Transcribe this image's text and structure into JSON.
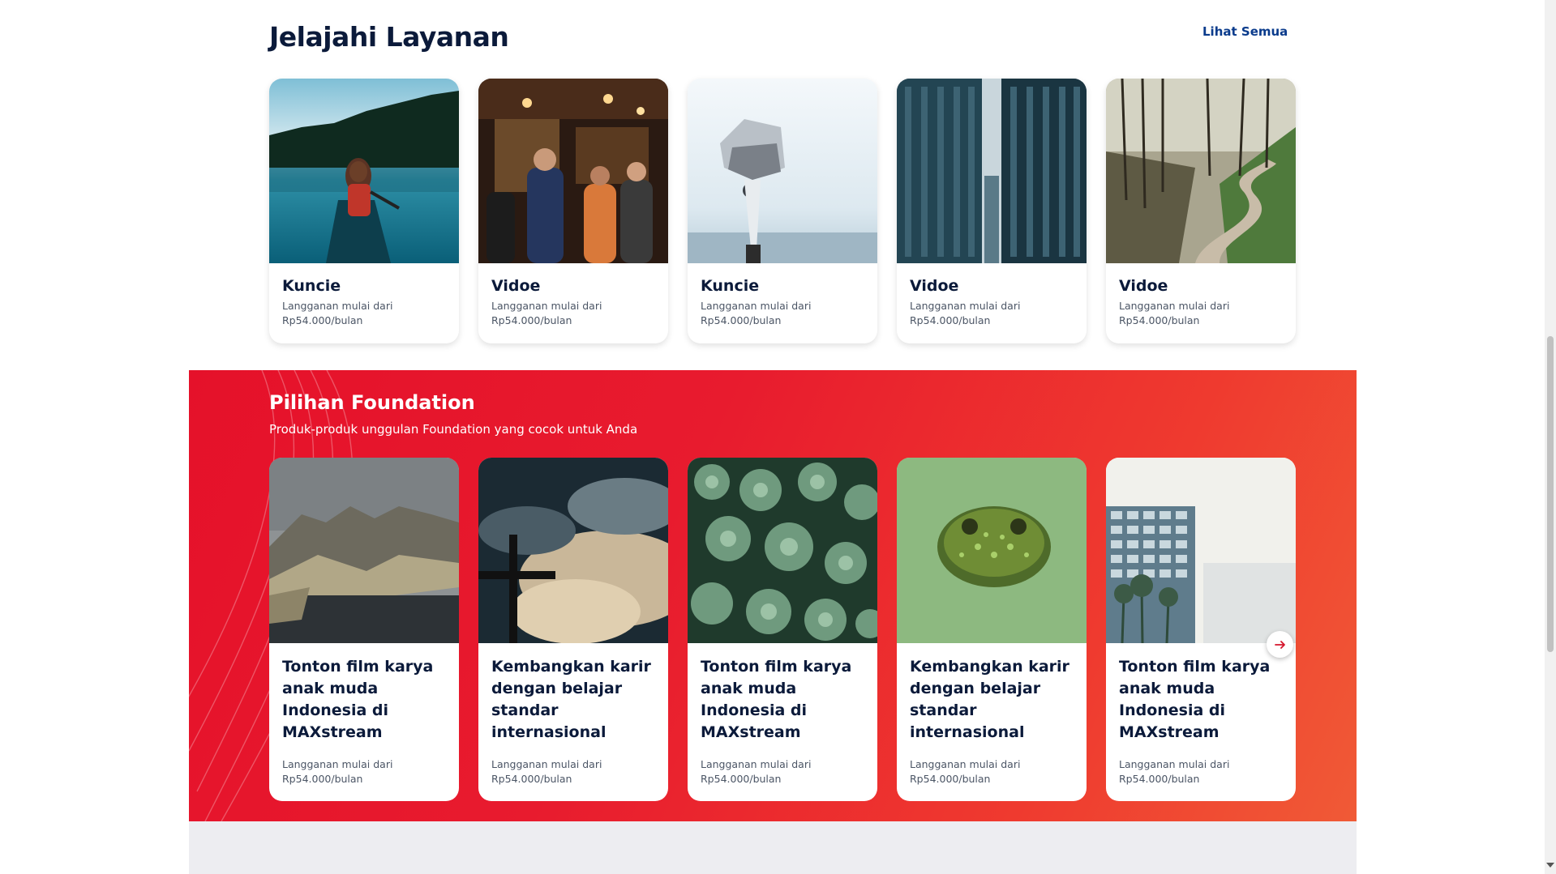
{
  "explore": {
    "title": "Jelajahi Layanan",
    "see_all": "Lihat Semua",
    "cards": [
      {
        "name": "Kuncie",
        "desc": "Langganan mulai dari Rp54.000/bulan",
        "image": "woman-in-canoe-lake"
      },
      {
        "name": "Vidoe",
        "desc": "Langganan mulai dari Rp54.000/bulan",
        "image": "crowded-bar"
      },
      {
        "name": "Kuncie",
        "desc": "Langganan mulai dari Rp54.000/bulan",
        "image": "coin-binocular-viewer"
      },
      {
        "name": "Vidoe",
        "desc": "Langganan mulai dari Rp54.000/bulan",
        "image": "city-skyscrapers"
      },
      {
        "name": "Vidoe",
        "desc": "Langganan mulai dari Rp54.000/bulan",
        "image": "forest-dirt-road"
      }
    ]
  },
  "foundation": {
    "title": "Pilihan Foundation",
    "subtitle": "Produk-produk unggulan Foundation yang cocok untuk Anda",
    "cards": [
      {
        "name": "Tonton film karya anak muda Indonesia di MAXstream",
        "desc": "Langganan mulai dari Rp54.000/bulan",
        "image": "rocky-coast-cliffs"
      },
      {
        "name": "Kembangkan karir dengan belajar standar internasional",
        "desc": "Langganan mulai dari Rp54.000/bulan",
        "image": "cross-against-cloudy-sky"
      },
      {
        "name": "Tonton film karya anak muda Indonesia di MAXstream",
        "desc": "Langganan mulai dari Rp54.000/bulan",
        "image": "succulent-plants"
      },
      {
        "name": "Kembangkan karir dengan belajar standar internasional",
        "desc": "Langganan mulai dari Rp54.000/bulan",
        "image": "frog-in-duckweed"
      },
      {
        "name": "Tonton film karya anak muda Indonesia di MAXstream",
        "desc": "Langganan mulai dari Rp54.000/bulan",
        "image": "apartment-building"
      }
    ],
    "next_icon": "arrow-right-icon"
  },
  "colors": {
    "heading": "#0b1a3a",
    "link": "#0a3b8c",
    "banner_red": "#e5112a",
    "banner_orange": "#f05a36"
  }
}
